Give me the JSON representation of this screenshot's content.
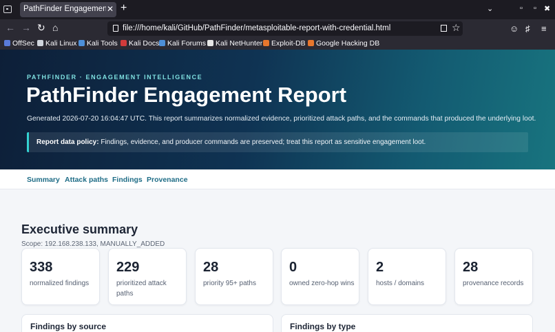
{
  "browser": {
    "tab_title": "PathFinder Engagement Rep",
    "tab_close": "✕",
    "new_tab": "+",
    "url": "file:///home/kali/GitHub/PathFinder/metasploitable-report-with-credential.html",
    "bookmarks": [
      {
        "label": "OffSec",
        "color": "#5a7bd9"
      },
      {
        "label": "Kali Linux",
        "color": "#cfd4dc"
      },
      {
        "label": "Kali Tools",
        "color": "#4d8fd8"
      },
      {
        "label": "Kali Docs",
        "color": "#d23b3b"
      },
      {
        "label": "Kali Forums",
        "color": "#4d8fd8"
      },
      {
        "label": "Kali NetHunter",
        "color": "#e6e6e6"
      },
      {
        "label": "Exploit-DB",
        "color": "#e8762c"
      },
      {
        "label": "Google Hacking DB",
        "color": "#e8762c"
      }
    ]
  },
  "hero": {
    "kicker": "PATHFINDER · ENGAGEMENT INTELLIGENCE",
    "title": "PathFinder Engagement Report",
    "generated": "Generated 2026-07-20 16:04:47 UTC. This report summarizes normalized evidence, prioritized attack paths, and the commands that produced the underlying loot.",
    "policy_label": "Report data policy:",
    "policy_text": " Findings, evidence, and producer commands are preserved; treat this report as sensitive engagement loot."
  },
  "nav": [
    "Summary",
    "Attack paths",
    "Findings",
    "Provenance"
  ],
  "summary": {
    "title": "Executive summary",
    "scope": "Scope: 192.168.238.133, MANUALLY_ADDED",
    "cards": [
      {
        "value": "338",
        "label": "normalized findings"
      },
      {
        "value": "229",
        "label": "prioritized attack paths"
      },
      {
        "value": "28",
        "label": "priority 95+ paths"
      },
      {
        "value": "0",
        "label": "owned zero-hop wins"
      },
      {
        "value": "2",
        "label": "hosts / domains"
      },
      {
        "value": "28",
        "label": "provenance records"
      }
    ],
    "panels": [
      "Findings by source",
      "Findings by type"
    ]
  },
  "colors": {
    "accent": "#34d2d2",
    "nav_link": "#1e6c86",
    "hero_dark": "#0d1f38",
    "hero_light": "#18747f"
  }
}
